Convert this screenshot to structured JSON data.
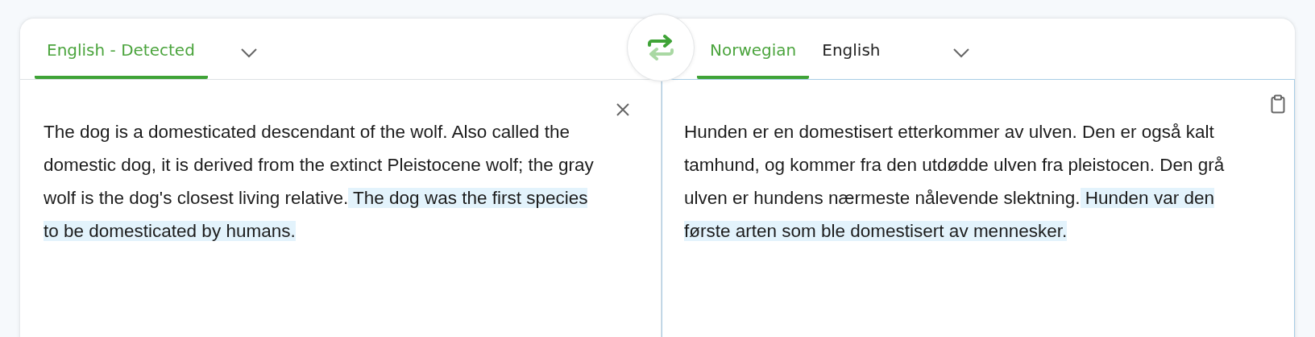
{
  "source": {
    "tabs": [
      {
        "label": "English - Detected",
        "selected": true
      }
    ],
    "text": [
      {
        "text": "The dog is a domesticated descendant of the wolf. Also called the domestic dog, it is derived from the extinct Pleistocene wolf; the gray wolf is the dog's closest living relative.",
        "highlighted": false
      },
      {
        "text": " The dog was the first species to be domesticated by humans.",
        "highlighted": true
      }
    ]
  },
  "target": {
    "focused": true,
    "tabs": [
      {
        "label": "Norwegian",
        "selected": true
      },
      {
        "label": "English",
        "selected": false
      }
    ],
    "text": [
      {
        "text": "Hunden er en domestisert etterkommer av ulven. Den er også kalt tamhund, og kommer fra den utdødde ulven fra pleistocen. Den grå ulven er hundens nærmeste nålevende slektning.",
        "highlighted": false
      },
      {
        "text": " Hunden var den første arten som ble domestisert av mennesker.",
        "highlighted": true
      }
    ]
  }
}
